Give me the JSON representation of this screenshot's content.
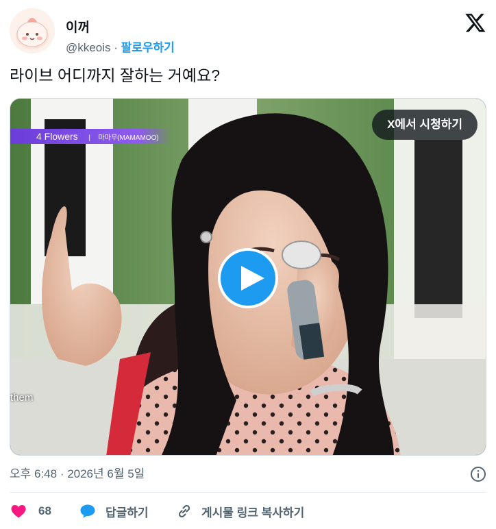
{
  "author": {
    "name": "이꺼",
    "handle": "@kkeois",
    "separator": "·",
    "follow_label": "팔로우하기"
  },
  "tweet": {
    "text": "라이브 어디까지 잘하는 거예요?"
  },
  "media": {
    "watch_label": "X에서 시청하기",
    "caption_song": "4 Flowers",
    "caption_sep": "|",
    "caption_artist": "마마무(MAMAMOO)",
    "subtitle_text": "them"
  },
  "meta": {
    "timestamp": "오후 6:48 · 2026년 6월 5일"
  },
  "actions": {
    "like_count": "68",
    "reply_label": "답글하기",
    "copy_link_label": "게시물 링크 복사하기"
  },
  "colors": {
    "accent": "#1d9bf0",
    "like": "#f91880",
    "secondary_text": "#536471"
  },
  "icons": [
    "x-logo-icon",
    "info-icon",
    "heart-icon",
    "reply-bubble-icon",
    "link-icon",
    "play-icon"
  ]
}
